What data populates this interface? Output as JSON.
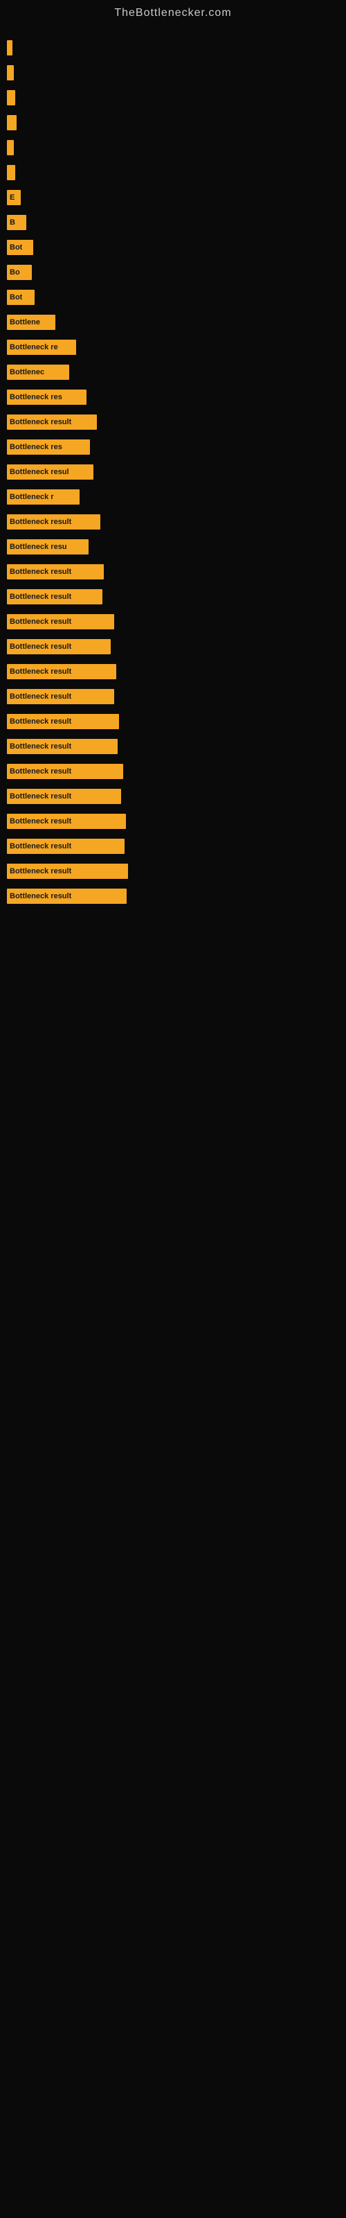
{
  "site_title": "TheBottlenecker.com",
  "bars": [
    {
      "id": 1,
      "width": 8,
      "label": ""
    },
    {
      "id": 2,
      "width": 10,
      "label": ""
    },
    {
      "id": 3,
      "width": 12,
      "label": ""
    },
    {
      "id": 4,
      "width": 14,
      "label": ""
    },
    {
      "id": 5,
      "width": 10,
      "label": ""
    },
    {
      "id": 6,
      "width": 12,
      "label": ""
    },
    {
      "id": 7,
      "width": 20,
      "label": "E"
    },
    {
      "id": 8,
      "width": 28,
      "label": "B"
    },
    {
      "id": 9,
      "width": 38,
      "label": "Bot"
    },
    {
      "id": 10,
      "width": 36,
      "label": "Bo"
    },
    {
      "id": 11,
      "width": 40,
      "label": "Bot"
    },
    {
      "id": 12,
      "width": 70,
      "label": "Bottlene"
    },
    {
      "id": 13,
      "width": 100,
      "label": "Bottleneck re"
    },
    {
      "id": 14,
      "width": 90,
      "label": "Bottlenec"
    },
    {
      "id": 15,
      "width": 115,
      "label": "Bottleneck res"
    },
    {
      "id": 16,
      "width": 130,
      "label": "Bottleneck result"
    },
    {
      "id": 17,
      "width": 120,
      "label": "Bottleneck res"
    },
    {
      "id": 18,
      "width": 125,
      "label": "Bottleneck resul"
    },
    {
      "id": 19,
      "width": 105,
      "label": "Bottleneck r"
    },
    {
      "id": 20,
      "width": 135,
      "label": "Bottleneck result"
    },
    {
      "id": 21,
      "width": 118,
      "label": "Bottleneck resu"
    },
    {
      "id": 22,
      "width": 140,
      "label": "Bottleneck result"
    },
    {
      "id": 23,
      "width": 138,
      "label": "Bottleneck result"
    },
    {
      "id": 24,
      "width": 155,
      "label": "Bottleneck result"
    },
    {
      "id": 25,
      "width": 150,
      "label": "Bottleneck result"
    },
    {
      "id": 26,
      "width": 158,
      "label": "Bottleneck result"
    },
    {
      "id": 27,
      "width": 155,
      "label": "Bottleneck result"
    },
    {
      "id": 28,
      "width": 162,
      "label": "Bottleneck result"
    },
    {
      "id": 29,
      "width": 160,
      "label": "Bottleneck result"
    },
    {
      "id": 30,
      "width": 168,
      "label": "Bottleneck result"
    },
    {
      "id": 31,
      "width": 165,
      "label": "Bottleneck result"
    },
    {
      "id": 32,
      "width": 172,
      "label": "Bottleneck result"
    },
    {
      "id": 33,
      "width": 170,
      "label": "Bottleneck result"
    },
    {
      "id": 34,
      "width": 175,
      "label": "Bottleneck result"
    },
    {
      "id": 35,
      "width": 173,
      "label": "Bottleneck result"
    }
  ]
}
